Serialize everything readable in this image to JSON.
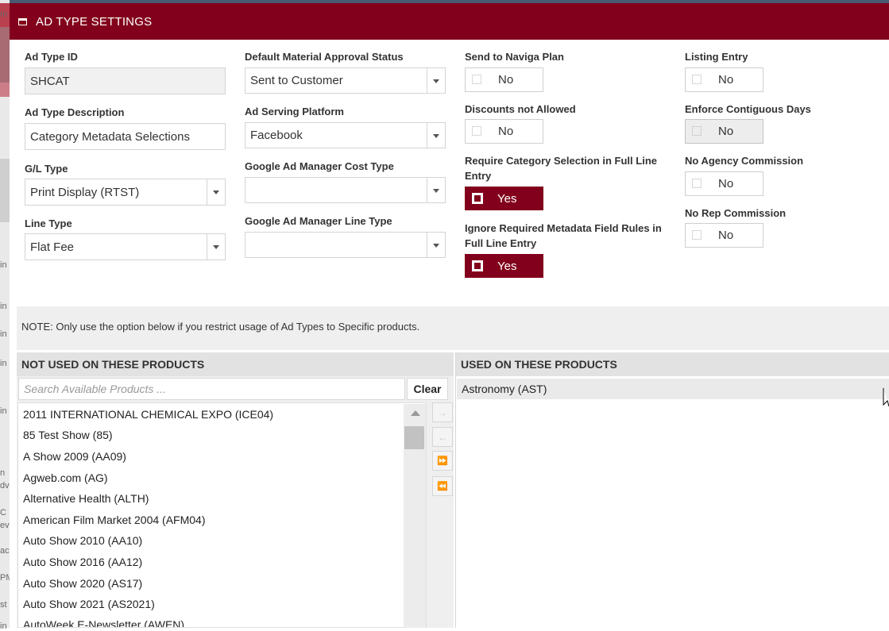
{
  "dialog": {
    "title": "AD TYPE SETTINGS"
  },
  "col1": {
    "ad_type_id": {
      "label": "Ad Type ID",
      "value": "SHCAT"
    },
    "ad_type_description": {
      "label": "Ad Type Description",
      "value": "Category Metadata Selections"
    },
    "gl_type": {
      "label": "G/L Type",
      "value": "Print Display (RTST)"
    },
    "line_type": {
      "label": "Line Type",
      "value": "Flat Fee"
    }
  },
  "col2": {
    "default_material_approval_status": {
      "label": "Default Material Approval Status",
      "value": "Sent to Customer"
    },
    "ad_serving_platform": {
      "label": "Ad Serving Platform",
      "value": "Facebook"
    },
    "gam_cost_type": {
      "label": "Google Ad Manager Cost Type",
      "value": ""
    },
    "gam_line_type": {
      "label": "Google Ad Manager Line Type",
      "value": ""
    }
  },
  "col3": {
    "send_to_naviga_plan": {
      "label": "Send to Naviga Plan",
      "value": "No"
    },
    "discounts_not_allowed": {
      "label": "Discounts not Allowed",
      "value": "No"
    },
    "require_category_selection": {
      "label": "Require Category Selection in Full Line Entry",
      "value": "Yes"
    },
    "ignore_required_metadata": {
      "label": "Ignore Required Metadata Field Rules in Full Line Entry",
      "value": "Yes"
    }
  },
  "col4": {
    "listing_entry": {
      "label": "Listing Entry",
      "value": "No"
    },
    "enforce_contiguous_days": {
      "label": "Enforce Contiguous Days",
      "value": "No"
    },
    "no_agency_commission": {
      "label": "No Agency Commission",
      "value": "No"
    },
    "no_rep_commission": {
      "label": "No Rep Commission",
      "value": "No"
    }
  },
  "note": "NOTE: Only use the option below if you restrict usage of Ad Types to Specific products.",
  "not_used": {
    "header": "NOT USED ON THESE PRODUCTS",
    "search_placeholder": "Search Available Products ...",
    "clear_label": "Clear",
    "items": [
      "2011 INTERNATIONAL CHEMICAL EXPO (ICE04)",
      "85 Test Show (85)",
      "A Show 2009 (AA09)",
      "Agweb.com (AG)",
      "Alternative Health (ALTH)",
      "American Film Market 2004 (AFM04)",
      "Auto Show 2010 (AA10)",
      "Auto Show 2016 (AA12)",
      "Auto Show 2020 (AS17)",
      "Auto Show 2021 (AS2021)",
      "AutoWeek E-Newsletter (AWEN)"
    ]
  },
  "used": {
    "header": "USED ON THESE PRODUCTS",
    "items": [
      "Astronomy (AST)"
    ]
  },
  "transfer_buttons": {
    "move_right": "→",
    "move_left": "←",
    "move_all_right": "⏩",
    "move_all_left": "⏪"
  },
  "background_hints": [
    "m",
    "in",
    "in",
    "in",
    "in",
    "in",
    "n",
    "dv",
    "C",
    "ev",
    "ac",
    "PM",
    "st",
    "in"
  ],
  "colors": {
    "accent": "#82001b",
    "panel_bg": "#efefef"
  }
}
